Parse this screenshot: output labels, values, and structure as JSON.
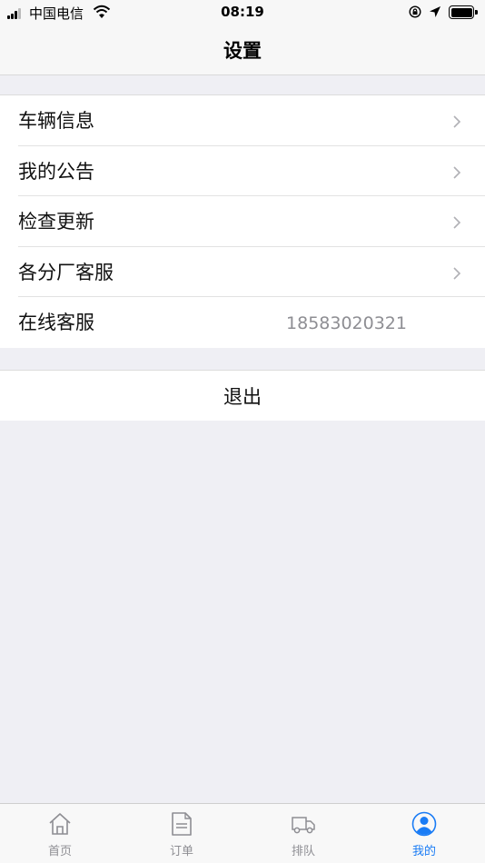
{
  "status_bar": {
    "carrier": "中国电信",
    "time": "08:19"
  },
  "nav": {
    "title": "设置"
  },
  "settings": {
    "items": [
      {
        "label": "车辆信息"
      },
      {
        "label": "我的公告"
      },
      {
        "label": "检查更新"
      },
      {
        "label": "各分厂客服"
      },
      {
        "label": "在线客服",
        "value": "18583020321"
      }
    ]
  },
  "logout_label": "退出",
  "tabs": [
    {
      "label": "首页",
      "icon": "home-icon"
    },
    {
      "label": "订单",
      "icon": "document-icon"
    },
    {
      "label": "排队",
      "icon": "truck-icon"
    },
    {
      "label": "我的",
      "icon": "user-icon",
      "active": true
    }
  ],
  "colors": {
    "accent": "#1a7cf5",
    "background": "#efeff4",
    "secondary_text": "#8e8e93"
  }
}
